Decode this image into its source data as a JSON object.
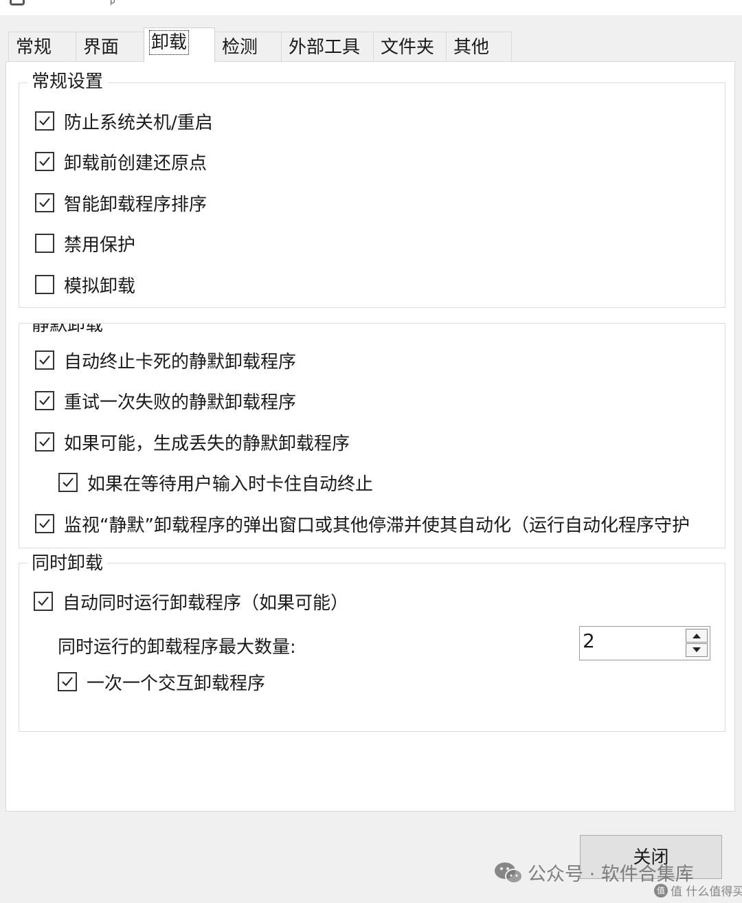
{
  "window": {
    "title_fragment": "p"
  },
  "tabs": [
    {
      "label": "常规"
    },
    {
      "label": "界面"
    },
    {
      "label": "卸载"
    },
    {
      "label": "检测"
    },
    {
      "label": "外部工具"
    },
    {
      "label": "文件夹"
    },
    {
      "label": "其他"
    }
  ],
  "active_tab": "卸载",
  "groups": {
    "general": {
      "title": "常规设置",
      "options": [
        {
          "label": "防止系统关机/重启",
          "checked": true
        },
        {
          "label": "卸载前创建还原点",
          "checked": true
        },
        {
          "label": "智能卸载程序排序",
          "checked": true
        },
        {
          "label": "禁用保护",
          "checked": false
        },
        {
          "label": "模拟卸载",
          "checked": false
        }
      ]
    },
    "quiet": {
      "title": "静默卸载",
      "options": [
        {
          "label": "自动终止卡死的静默卸载程序",
          "checked": true
        },
        {
          "label": "重试一次失败的静默卸载程序",
          "checked": true
        },
        {
          "label": "如果可能，生成丢失的静默卸载程序",
          "checked": true
        },
        {
          "label": "如果在等待用户输入时卡住自动终止",
          "checked": true
        },
        {
          "label": "监视“静默”卸载程序的弹出窗口或其他停滞并使其自动化（运行自动化程序守护",
          "checked": true
        }
      ]
    },
    "concurrent": {
      "title": "同时卸载",
      "auto_run": {
        "label": "自动同时运行卸载程序（如果可能）",
        "checked": true
      },
      "max_label": "同时运行的卸载程序最大数量:",
      "max_value": "2",
      "one_interactive": {
        "label": "一次一个交互卸载程序",
        "checked": true
      }
    }
  },
  "buttons": {
    "close": "关闭"
  },
  "watermark": {
    "text": "公众号 · 软件合集库",
    "site": "值 什么值得买"
  }
}
